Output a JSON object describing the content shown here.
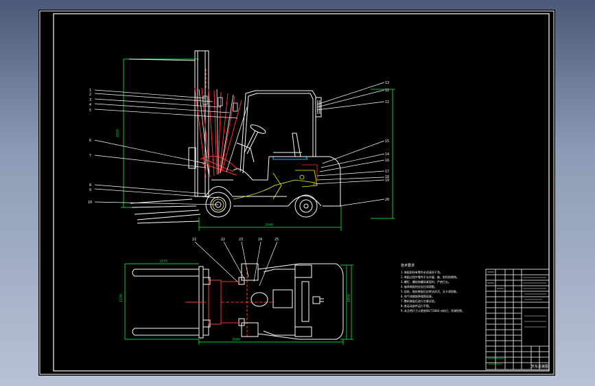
{
  "drawing": {
    "title": "",
    "background": "#000000",
    "frame_color": "#ffffff",
    "colors": {
      "outline": "#ffffff",
      "mast": "#ff3333",
      "leader": "#ffffff",
      "dimension": "#00cc33",
      "seat": "#00ccff",
      "wiring": "#ffff00",
      "title_block": "#ffffff"
    }
  },
  "side_view": {
    "dim_length": "2640",
    "dim_height": "2020",
    "leaders_left": [
      "1",
      "2",
      "3",
      "4",
      "5",
      "6",
      "7",
      "8",
      "9",
      "10"
    ],
    "leaders_right": [
      "13",
      "12",
      "11",
      "15",
      "14",
      "16",
      "17",
      "18",
      "19",
      "20"
    ]
  },
  "top_view": {
    "dim_fork": "1070",
    "dim_overall": "3500",
    "dim_width": "1180",
    "dim_track": "1050",
    "dim_side": "1180",
    "leaders_top": [
      "21",
      "22",
      "23",
      "24",
      "25"
    ]
  },
  "notes": {
    "heading": "技术要求",
    "lines": [
      "1.装配前所有零件必须清洗干净。",
      "2.装配过程中零件不允许磕、碰、划伤和锈蚀。",
      "3.螺钉、螺栓和螺母紧固时，严禁打击。",
      "4.轴承装配时应加注润滑脂。",
      "5.齿轮、链轮装配后应转动灵活，无卡滞现象。",
      "6.电气线路按原理图连接。",
      "7.整机装配后进行空载试验。",
      "8.各运动部件运行平稳。",
      "9.未注明尺寸公差按GB/T1804-m执行，涂漆防锈。"
    ]
  },
  "title_block": {
    "drawing_title": "叉车总装图",
    "rows": [
      "",
      "",
      "",
      "",
      "",
      "",
      "",
      "",
      "",
      ""
    ]
  }
}
